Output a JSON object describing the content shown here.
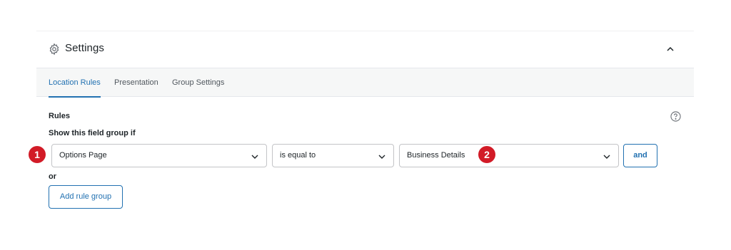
{
  "settings": {
    "title": "Settings",
    "gear_icon": "gear-icon",
    "collapse_icon": "chevron-up-icon"
  },
  "tabs": [
    {
      "label": "Location Rules",
      "active": true
    },
    {
      "label": "Presentation",
      "active": false
    },
    {
      "label": "Group Settings",
      "active": false
    }
  ],
  "rules": {
    "label": "Rules",
    "help_icon": "question-circle-icon",
    "show_if_label": "Show this field group if",
    "param_select": "Options Page",
    "operator_select": "is equal to",
    "value_select": "Business Details",
    "and_label": "and",
    "or_label": "or",
    "add_group_label": "Add rule group"
  },
  "annotations": {
    "marker_1": "1",
    "marker_2": "2",
    "color": "#d21b27"
  },
  "colors": {
    "accent": "#2271b1",
    "tab_bar_bg": "#f6f7f7",
    "border": "#c3c4c7"
  }
}
